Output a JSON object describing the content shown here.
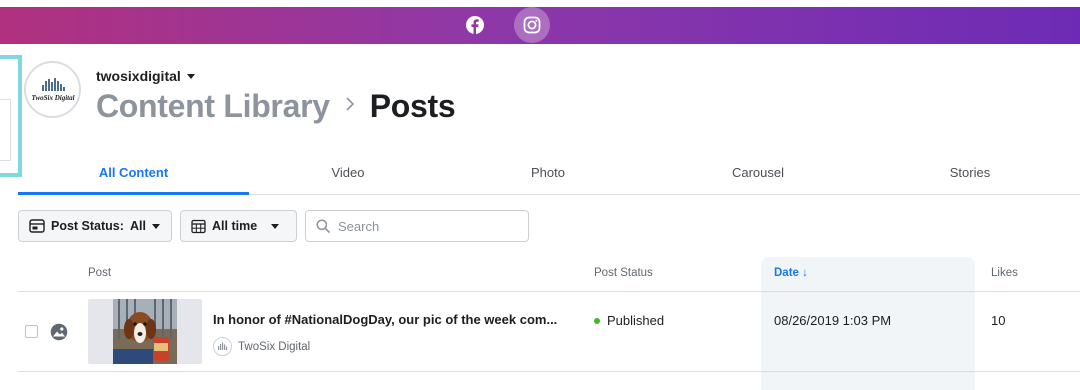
{
  "colors": {
    "accent": "#1877f2",
    "published": "#42b72a",
    "header_gradient_start": "#b0317f",
    "header_gradient_end": "#6d2bb5"
  },
  "platforms": [
    {
      "name": "Facebook",
      "icon": "facebook-icon",
      "selected": false
    },
    {
      "name": "Instagram",
      "icon": "instagram-icon",
      "selected": true
    }
  ],
  "account": {
    "name": "twosixdigital",
    "logo_text": "TwoSix Digital"
  },
  "breadcrumb": {
    "parent": "Content Library",
    "separator": "›",
    "current": "Posts"
  },
  "tabs": [
    {
      "label": "All Content",
      "active": true
    },
    {
      "label": "Video",
      "active": false
    },
    {
      "label": "Photo",
      "active": false
    },
    {
      "label": "Carousel",
      "active": false
    },
    {
      "label": "Stories",
      "active": false
    }
  ],
  "filters": {
    "post_status_label": "Post Status:",
    "post_status_value": "All",
    "time_value": "All time",
    "search_placeholder": "Search"
  },
  "table": {
    "columns": {
      "post": "Post",
      "status": "Post Status",
      "date": "Date ↓",
      "likes": "Likes"
    },
    "sorted_column": "date",
    "rows": [
      {
        "text": "In honor of #NationalDogDay, our pic of the week com...",
        "author": "TwoSix Digital",
        "status": "Published",
        "date": "08/26/2019 1:03 PM",
        "likes": "10",
        "media_type_icon": "photo-type-icon"
      }
    ]
  }
}
